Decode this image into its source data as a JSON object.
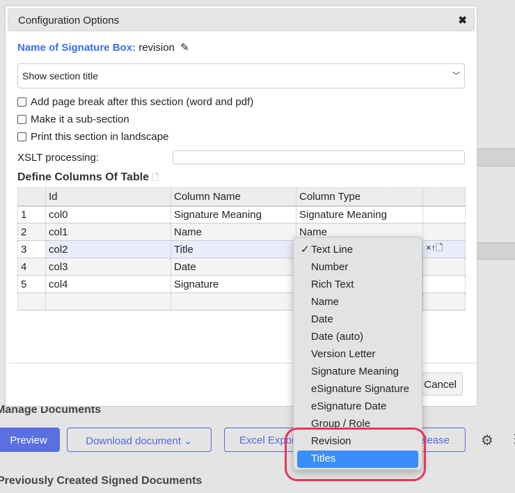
{
  "dialog": {
    "title": "Configuration Options",
    "close": "✖",
    "name_label": "Name of Signature Box:",
    "name_value": "revision",
    "edit_icon": "pencil-icon",
    "section_select": "Show section title",
    "checkboxes": [
      "Add page break after this section (word and pdf)",
      "Make it a sub-section",
      "Print this section in landscape"
    ],
    "xslt_label": "XSLT processing:",
    "xslt_value": "",
    "table_title": "Define Columns Of Table",
    "headers": [
      "",
      "Id",
      "Column Name",
      "Column Type",
      ""
    ],
    "rows": [
      [
        "1",
        "col0",
        "Signature Meaning",
        "Signature Meaning"
      ],
      [
        "2",
        "col1",
        "Name",
        "Name"
      ],
      [
        "3",
        "col2",
        "Title",
        ""
      ],
      [
        "4",
        "col3",
        "Date",
        ""
      ],
      [
        "5",
        "col4",
        "Signature",
        ""
      ]
    ],
    "row_actions": [
      "×",
      "↑"
    ],
    "cancel": "Cancel"
  },
  "dropdown": {
    "selected": "Text Line",
    "highlighted": "Titles",
    "options": [
      "Text Line",
      "Number",
      "Rich Text",
      "Name",
      "Date",
      "Date (auto)",
      "Version Letter",
      "Signature Meaning",
      "eSignature Signature",
      "eSignature Date",
      "Group / Role",
      "Revision",
      "Titles"
    ],
    "highlight_color": "#3a8ef8",
    "annotation_color": "#e8355a"
  },
  "background": {
    "manage_heading": "Manage Documents",
    "preview": "Preview",
    "download": "Download document",
    "excel": "Excel Export",
    "release": "Release",
    "previous_heading": "Previously Created Signed Documents"
  }
}
